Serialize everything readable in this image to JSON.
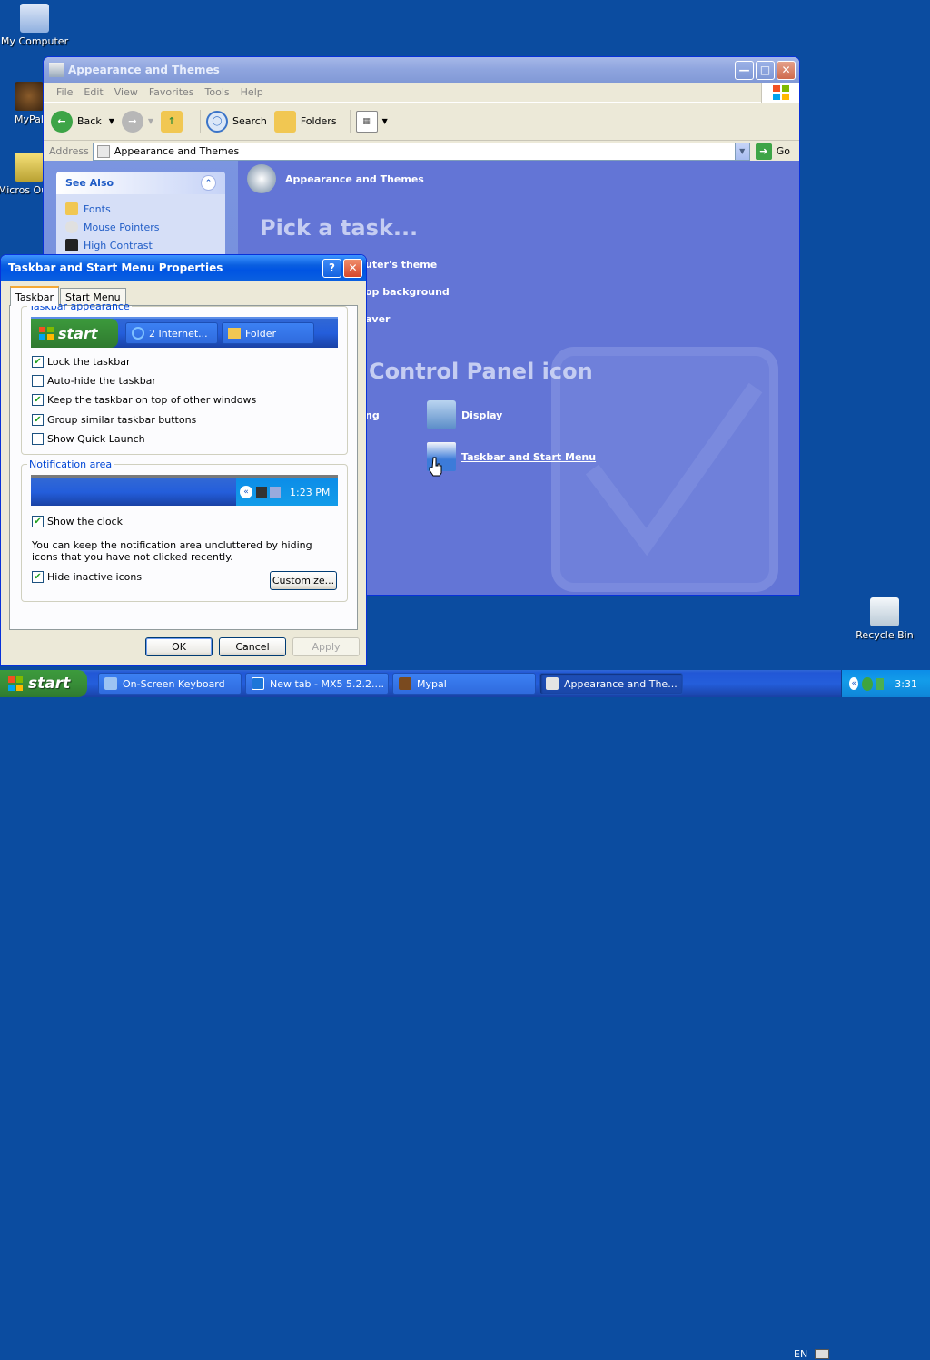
{
  "desktop": {
    "icons": [
      {
        "label": "My Computer",
        "icon": "computer-icon"
      },
      {
        "label": "MyPal",
        "icon": "mypal-icon"
      },
      {
        "label": "Micros Outlo",
        "icon": "outlook-icon"
      },
      {
        "label": "Recycle Bin",
        "icon": "recycle-bin-icon"
      }
    ]
  },
  "explorer": {
    "title": "Appearance and Themes",
    "menu": [
      "File",
      "Edit",
      "View",
      "Favorites",
      "Tools",
      "Help"
    ],
    "toolbar": {
      "back": "Back",
      "search": "Search",
      "folders": "Folders"
    },
    "address": {
      "label": "Address",
      "value": "Appearance and Themes",
      "go": "Go"
    },
    "see_also": {
      "title": "See Also",
      "items": [
        "Fonts",
        "Mouse Pointers",
        "High Contrast"
      ]
    },
    "header": "Appearance and Themes",
    "pick_task": "Pick a task...",
    "tasks": [
      "uter's theme",
      "op background",
      "aver"
    ],
    "pick_icon": "Control Panel icon",
    "icons": {
      "left_partial": "ng",
      "display": "Display",
      "taskbar": "Taskbar and Start Menu"
    }
  },
  "dialog": {
    "title": "Taskbar and Start Menu Properties",
    "help": "?",
    "tabs": [
      "Taskbar",
      "Start Menu"
    ],
    "appearance_group": "Taskbar appearance",
    "preview": {
      "start": "start",
      "ie_button": "2 Internet...",
      "folder_button": "Folder"
    },
    "options": [
      {
        "label": "Lock the taskbar",
        "checked": true
      },
      {
        "label": "Auto-hide the taskbar",
        "checked": false
      },
      {
        "label": "Keep the taskbar on top of other windows",
        "checked": true
      },
      {
        "label": "Group similar taskbar buttons",
        "checked": true
      },
      {
        "label": "Show Quick Launch",
        "checked": false
      }
    ],
    "notification_group": "Notification area",
    "clock_preview": "1:23 PM",
    "show_clock": {
      "label": "Show the clock",
      "checked": true
    },
    "note": "You can keep the notification area uncluttered by hiding icons that you have not clicked recently.",
    "hide_inactive": {
      "label": "Hide inactive icons",
      "checked": true
    },
    "customize": "Customize...",
    "ok": "OK",
    "cancel": "Cancel",
    "apply": "Apply"
  },
  "taskbar": {
    "start": "start",
    "tasks": [
      {
        "label": "On-Screen Keyboard",
        "active": false
      },
      {
        "label": "New tab - MX5 5.2.2....",
        "active": false
      },
      {
        "label": "Mypal",
        "active": false
      },
      {
        "label": "Appearance and The...",
        "active": true
      }
    ],
    "language": "EN",
    "clock": "3:31"
  }
}
